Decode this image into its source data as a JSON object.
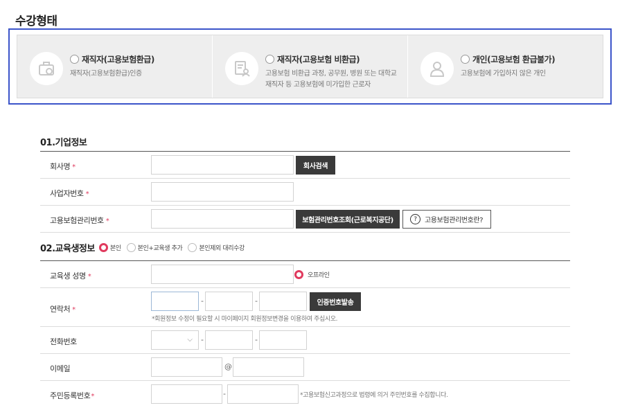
{
  "section_title": "수강형태",
  "types": [
    {
      "icon": "briefcase-icon",
      "label": "재직자(고용보험환급)",
      "desc": "재직자(고용보험환급)인증"
    },
    {
      "icon": "document-user-icon",
      "label": "재직자(고용보험 비환급)",
      "desc": "고용보험 비환급 과정, 공무원, 병원 또는 대학교 재직자 등 고용보험에 미가입한 근로자"
    },
    {
      "icon": "person-icon",
      "label": "개인(고용보험 환급불가)",
      "desc": "고용보험에 가입하지 않은 개인"
    }
  ],
  "company": {
    "heading": "01.기업정보",
    "name_label": "회사명",
    "search_btn": "회사검색",
    "bizno_label": "사업자번호",
    "insno_label": "고용보험관리번호",
    "insno_lookup_btn": "보험관리번호조회(근로복지공단)",
    "insno_help_btn": "고용보험관리번호란?"
  },
  "student": {
    "heading": "02.교육생정보",
    "options": [
      "본인",
      "본인+교육생 추가",
      "본인제외 대리수강"
    ],
    "name_label": "교육생 성명",
    "offline_label": "오프라인",
    "contact_label": "연락처",
    "dash": "-",
    "auth_btn": "인증번호발송",
    "contact_note": "*회원정보 수정이 필요할 시 마이페이지 회원정보변경을 이용하여 주십시오.",
    "phone_label": "전화번호",
    "chevron": "⌵",
    "email_label": "이메일",
    "at": "@",
    "rrn_label": "주민등록번호",
    "rrn_note": "*고용보험신고과정으로 법령에 의거 주민번호를 수집합니다.",
    "required_mark": "*"
  }
}
